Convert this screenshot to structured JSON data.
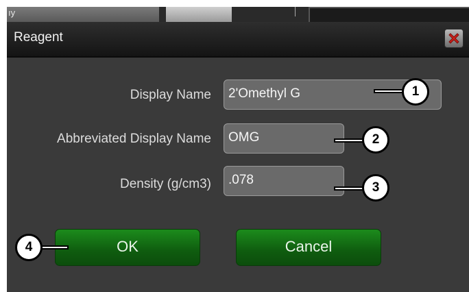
{
  "background_app": {
    "tab_fragment": "ıy"
  },
  "dialog": {
    "title": "Reagent",
    "close_icon": "close-icon-red-x",
    "fields": {
      "display_name": {
        "label": "Display Name",
        "value": "2'Omethyl G"
      },
      "abbreviated_display_name": {
        "label": "Abbreviated Display Name",
        "value": "OMG"
      },
      "density": {
        "label": "Density (g/cm3)",
        "value": ".078"
      }
    },
    "buttons": {
      "ok": "OK",
      "cancel": "Cancel"
    }
  },
  "callouts": [
    "1",
    "2",
    "3",
    "4"
  ],
  "colors": {
    "dialog_bg": "#3a3a3a",
    "button_green": "#0f5c0f",
    "close_red": "#d0211b"
  }
}
